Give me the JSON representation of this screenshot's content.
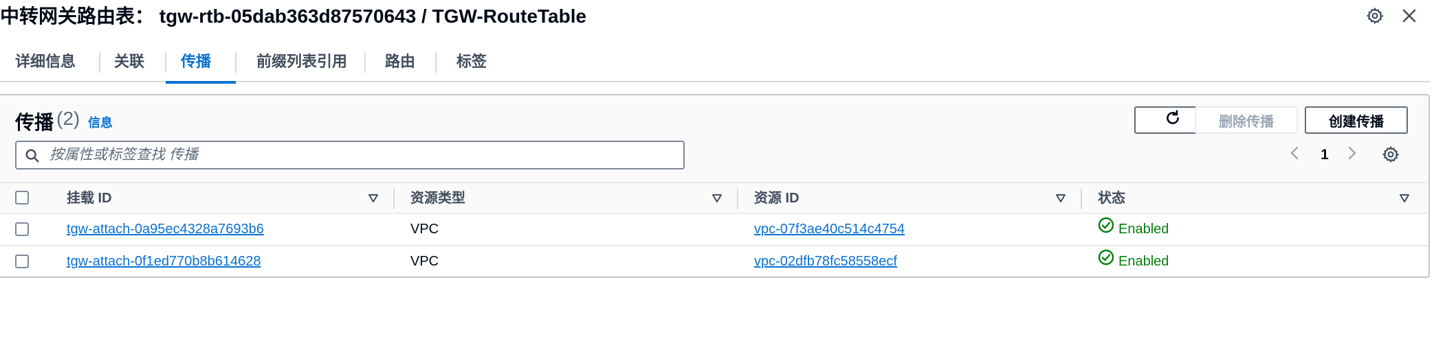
{
  "header": {
    "title": "中转网关路由表： tgw-rtb-05dab363d87570643 / TGW-RouteTable",
    "settings_icon": "gear-icon",
    "close_icon": "close-icon"
  },
  "tabs": [
    {
      "label": "详细信息",
      "active": false
    },
    {
      "label": "关联",
      "active": false
    },
    {
      "label": "传播",
      "active": true
    },
    {
      "label": "前缀列表引用",
      "active": false
    },
    {
      "label": "路由",
      "active": false
    },
    {
      "label": "标签",
      "active": false
    }
  ],
  "panel": {
    "title": "传播",
    "count": "(2)",
    "info_link": "信息",
    "refresh_icon": "refresh-icon",
    "delete_button": "删除传播",
    "create_button": "创建传播",
    "search": {
      "placeholder": "按属性或标签查找 传播",
      "value": ""
    },
    "pagination": {
      "current_page": "1"
    }
  },
  "table": {
    "columns": [
      "挂载 ID",
      "资源类型",
      "资源 ID",
      "状态"
    ],
    "rows": [
      {
        "attachment_id": "tgw-attach-0a95ec4328a7693b6",
        "resource_type": "VPC",
        "resource_id": "vpc-07f3ae40c514c4754",
        "status": "Enabled"
      },
      {
        "attachment_id": "tgw-attach-0f1ed770b8b614628",
        "resource_type": "VPC",
        "resource_id": "vpc-02dfb78fc58558ecf",
        "status": "Enabled"
      }
    ]
  },
  "colors": {
    "accent": "#0972d3",
    "success": "#037f0c",
    "text": "#000716",
    "border": "#c6c6cd"
  }
}
